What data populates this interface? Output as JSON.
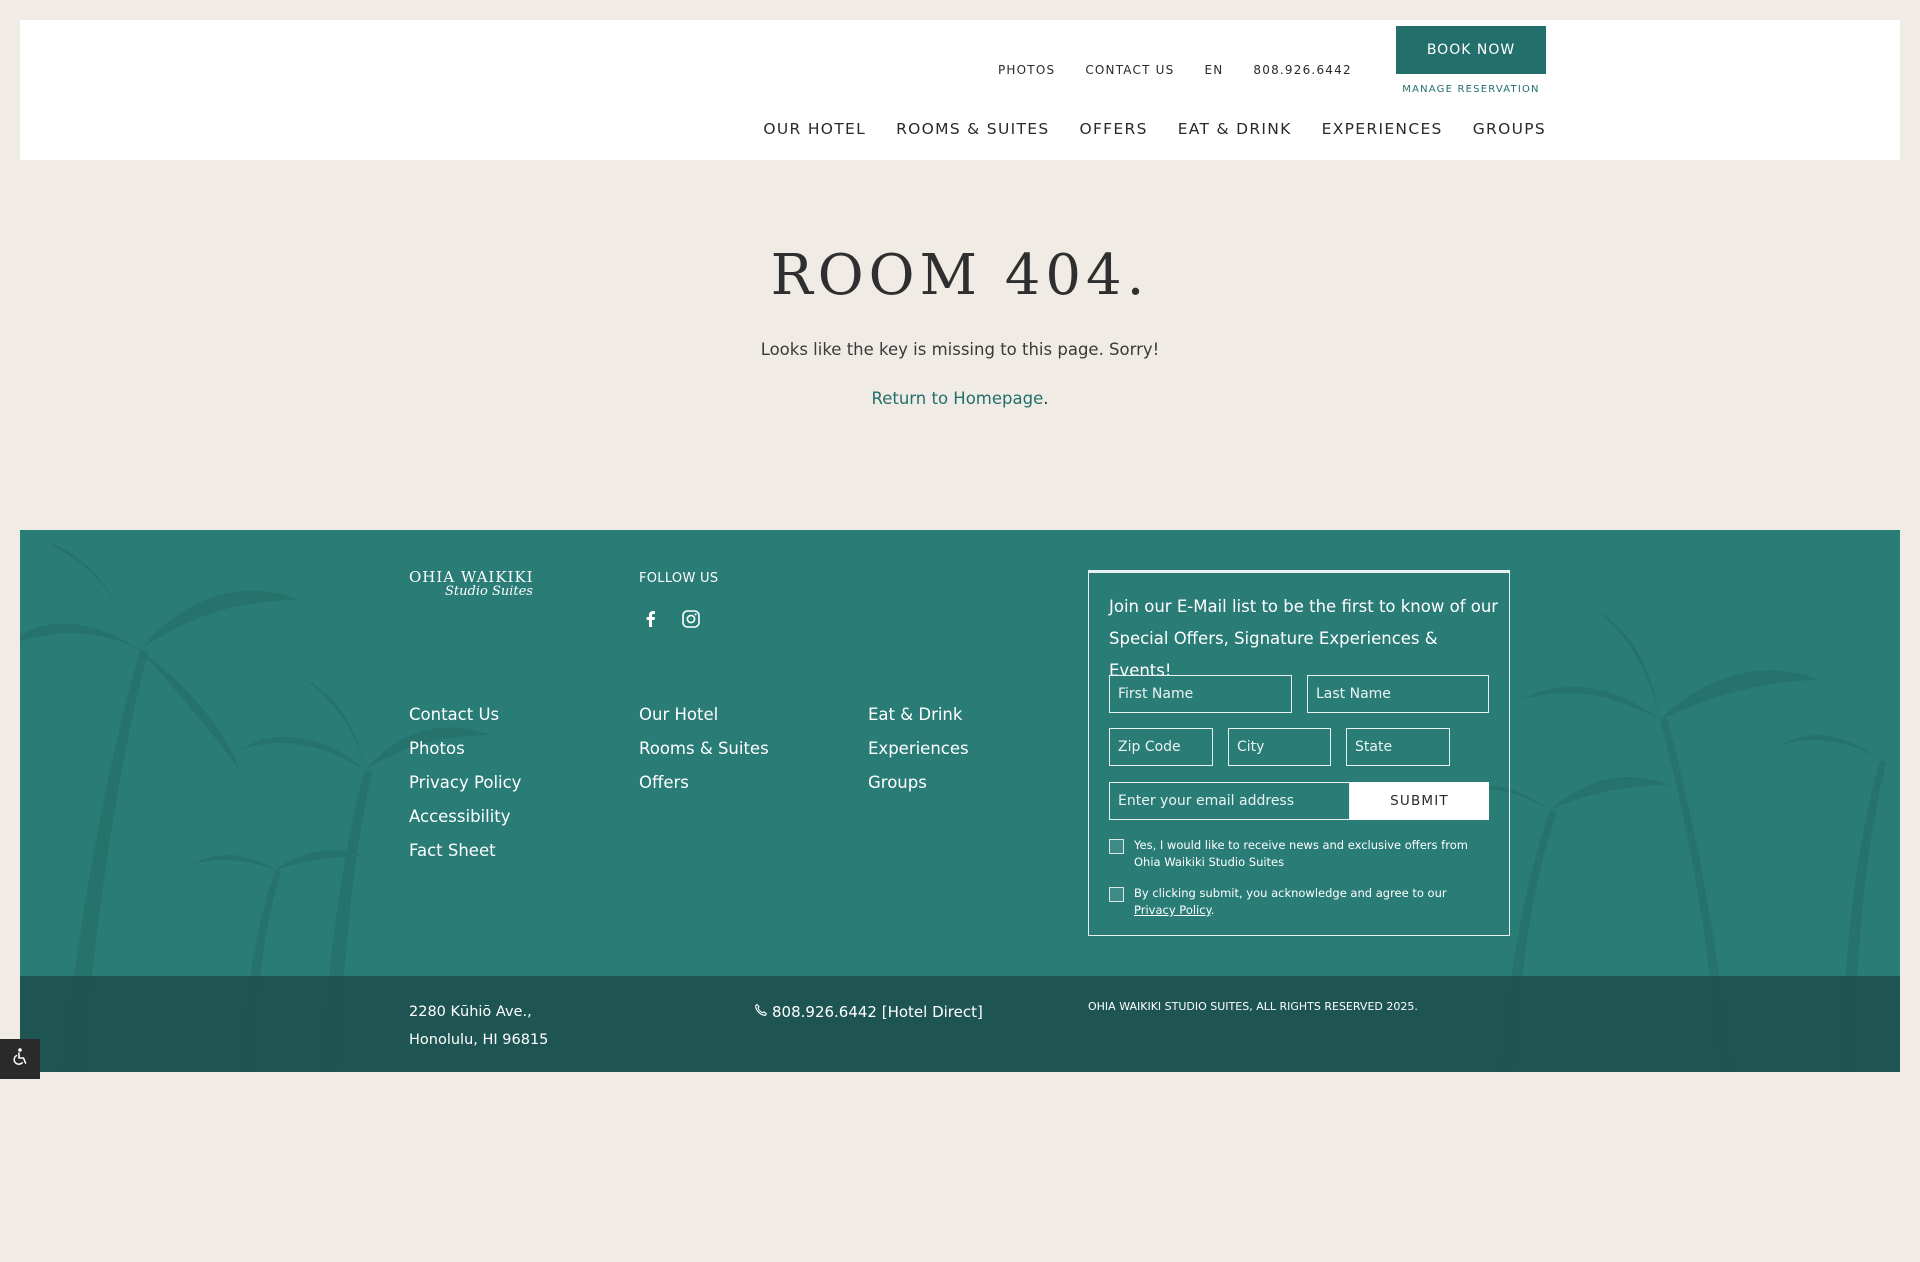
{
  "header": {
    "util_links": [
      "PHOTOS",
      "CONTACT US",
      "EN",
      "808.926.6442"
    ],
    "book_label": "BOOK NOW",
    "manage_label": "MANAGE RESERVATION",
    "nav": [
      "OUR HOTEL",
      "ROOMS & SUITES",
      "OFFERS",
      "EAT & DRINK",
      "EXPERIENCES",
      "GROUPS"
    ]
  },
  "error": {
    "title": "ROOM 404.",
    "message": "Looks like the key is missing to this page. Sorry!",
    "return_link": "Return to Homepage",
    "return_suffix": "."
  },
  "footer": {
    "logo": {
      "line1": "OHIA WAIKIKI",
      "line2": "Studio Suites"
    },
    "follow_label": "FOLLOW US",
    "social_icons": [
      "facebook-icon",
      "instagram-icon"
    ],
    "col1": [
      "Contact Us",
      "Photos",
      "Privacy Policy",
      "Accessibility",
      "Fact Sheet"
    ],
    "col2": [
      "Our Hotel",
      "Rooms & Suites",
      "Offers"
    ],
    "col3": [
      "Eat & Drink",
      "Experiences",
      "Groups"
    ],
    "signup": {
      "heading": "Join our E-Mail list to be the first to know of our Special Offers, Signature Experiences & Events!",
      "first_name_placeholder": "First Name",
      "last_name_placeholder": "Last Name",
      "zip_placeholder": "Zip Code",
      "city_placeholder": "City",
      "state_placeholder": "State",
      "email_placeholder": "Enter your email address",
      "submit_label": "SUBMIT",
      "consent1": "Yes, I would like to receive news and exclusive offers from Ohia Waikiki Studio Suites",
      "consent2_prefix": "By clicking submit, you acknowledge and agree to our ",
      "consent2_link": "Privacy Policy",
      "consent2_suffix": "."
    },
    "address_line1": "2280 Kūhiō Ave.,",
    "address_line2": "Honolulu, HI 96815",
    "phone": "808.926.6442 [Hotel Direct]",
    "copyright": "OHIA WAIKIKI STUDIO SUITES, ALL RIGHTS RESERVED 2025."
  },
  "colors": {
    "accent": "#236f6c",
    "footer_bg": "#2a7c77",
    "page_bg": "#f0ebe4"
  }
}
